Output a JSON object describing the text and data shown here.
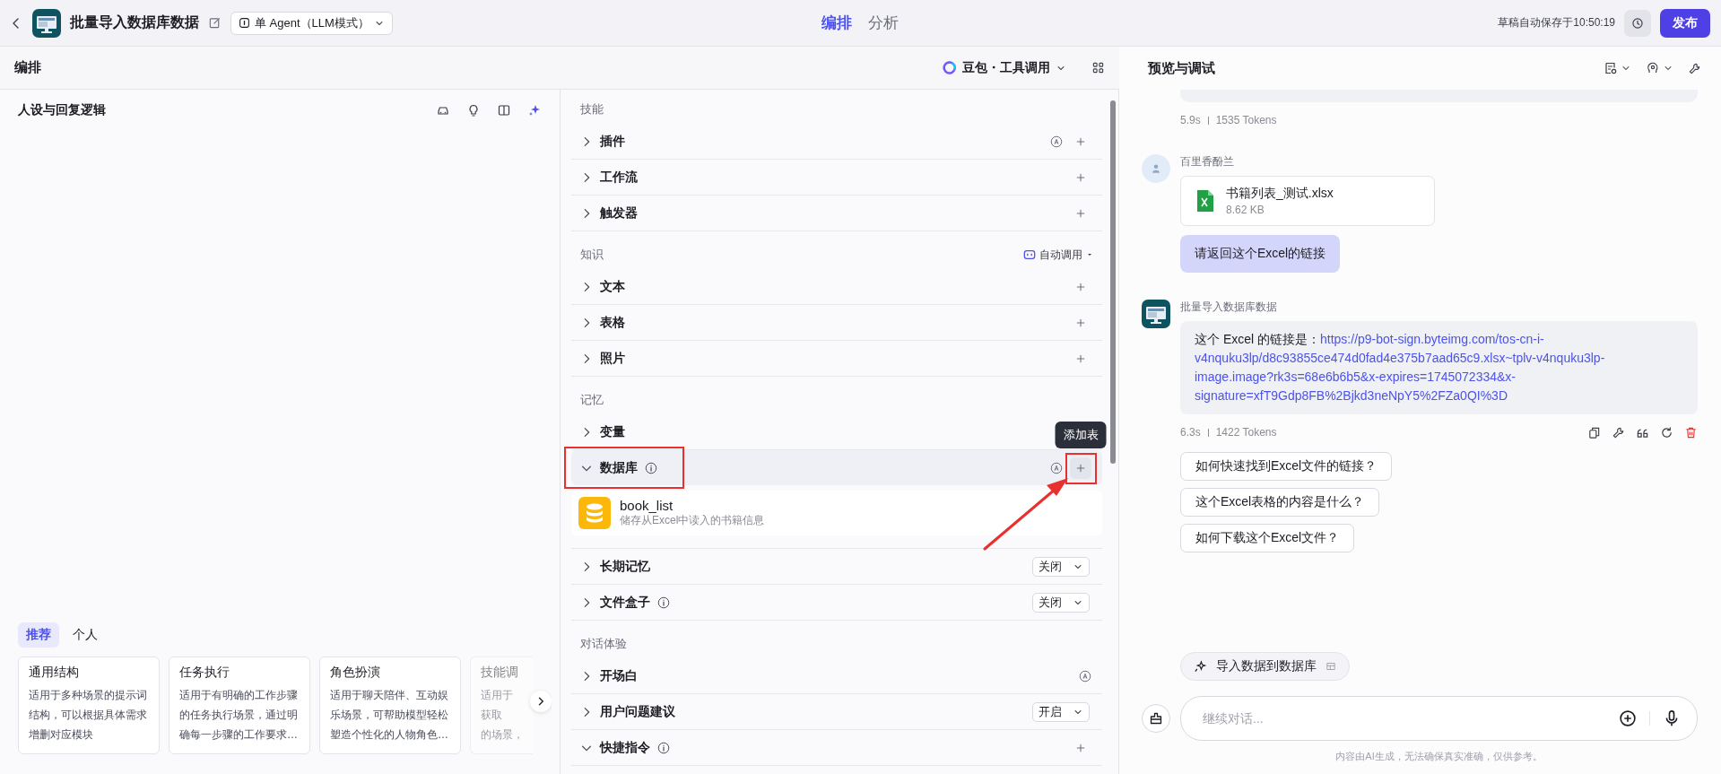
{
  "topbar": {
    "title": "批量导入数据库数据",
    "agent_mode": "单 Agent（LLM模式）",
    "tabs": [
      {
        "label": "编排",
        "selected": true
      },
      {
        "label": "分析",
        "selected": false
      }
    ],
    "autosave": "草稿自动保存于10:50:19",
    "publish": "发布"
  },
  "arrange": {
    "title": "编排",
    "model": "豆包・工具调用"
  },
  "prompt": {
    "title": "人设与回复逻辑",
    "template_tabs": [
      {
        "label": "推荐",
        "selected": true
      },
      {
        "label": "个人",
        "selected": false
      }
    ],
    "templates": [
      {
        "kind": "full",
        "title": "通用结构",
        "description": "适用于多种场景的提示词结构，可以根据具体需求增删对应模块"
      },
      {
        "kind": "full",
        "title": "任务执行",
        "description": "适用于有明确的工作步骤的任务执行场景，通过明确每一步骤的工作要求…"
      },
      {
        "kind": "full",
        "title": "角色扮演",
        "description": "适用于聊天陪伴、互动娱乐场景，可帮助模型轻松塑造个性化的人物角色…"
      },
      {
        "kind": "cut",
        "title": "技能调",
        "lines": [
          "适用于",
          "获取",
          "的场景，"
        ]
      }
    ]
  },
  "skills": {
    "sections": [
      {
        "title": "技能",
        "items": [
          {
            "label": "插件",
            "expanded": false,
            "hovered": false,
            "auto": true,
            "add": true
          },
          {
            "label": "工作流",
            "expanded": false,
            "hovered": false,
            "add": true
          },
          {
            "label": "触发器",
            "expanded": false,
            "hovered": false,
            "add": true
          }
        ]
      },
      {
        "title": "知识",
        "mode": "自动调用",
        "items": [
          {
            "label": "文本",
            "expanded": false,
            "hovered": false,
            "add": true
          },
          {
            "label": "表格",
            "expanded": false,
            "hovered": false,
            "add": true
          },
          {
            "label": "照片",
            "expanded": false,
            "hovered": false,
            "add": true
          }
        ]
      },
      {
        "title": "记忆",
        "items": [
          {
            "label": "变量",
            "expanded": false,
            "hovered": false
          },
          {
            "label": "数据库",
            "expanded": true,
            "hovered": true,
            "info": true,
            "auto": true,
            "add": true,
            "annotated": true,
            "tooltip": "添加表",
            "children": [
              {
                "name": "book_list",
                "description": "储存从Excel中读入的书籍信息"
              }
            ]
          },
          {
            "label": "长期记忆",
            "expanded": false,
            "hovered": false,
            "select": "关闭"
          },
          {
            "label": "文件盒子",
            "expanded": false,
            "hovered": false,
            "info": true,
            "select": "关闭"
          }
        ]
      },
      {
        "title": "对话体验",
        "items": [
          {
            "label": "开场白",
            "expanded": false,
            "hovered": false,
            "auto": true
          },
          {
            "label": "用户问题建议",
            "expanded": false,
            "hovered": false,
            "select": "开启"
          },
          {
            "label": "快捷指令",
            "expanded": true,
            "hovered": false,
            "info": true,
            "add": true
          }
        ]
      }
    ]
  },
  "preview": {
    "title": "预览与调试",
    "messages": [
      {
        "kind": "cut",
        "time": "5.9s",
        "tokens": "1535 Tokens"
      },
      {
        "kind": "user",
        "sender": "百里香酚兰",
        "file": {
          "name": "书籍列表_测试.xlsx",
          "size": "8.62 KB"
        },
        "text": "请返回这个Excel的链接"
      },
      {
        "kind": "bot",
        "sender": "批量导入数据库数据",
        "text": "这个 Excel 的链接是：",
        "link": "https://p9-bot-sign.byteimg.com/tos-cn-i-v4nquku3lp/d8c93855ce474d0fad4e375b7aad65c9.xlsx~tplv-v4nquku3lp-image.image?rk3s=68e6b6b5&x-expires=1745072334&x-signature=xfT9Gdp8FB%2Bjkd3neNpY5%2FZa0QI%3D",
        "time": "6.3s",
        "tokens": "1422 Tokens"
      }
    ],
    "suggestions": [
      "如何快速找到Excel文件的链接？",
      "这个Excel表格的内容是什么？",
      "如何下载这个Excel文件？"
    ],
    "shortcut": "导入数据到数据库",
    "placeholder": "继续对话...",
    "disclaimer": "内容由AI生成，无法确保真实准确，仅供参考。"
  }
}
